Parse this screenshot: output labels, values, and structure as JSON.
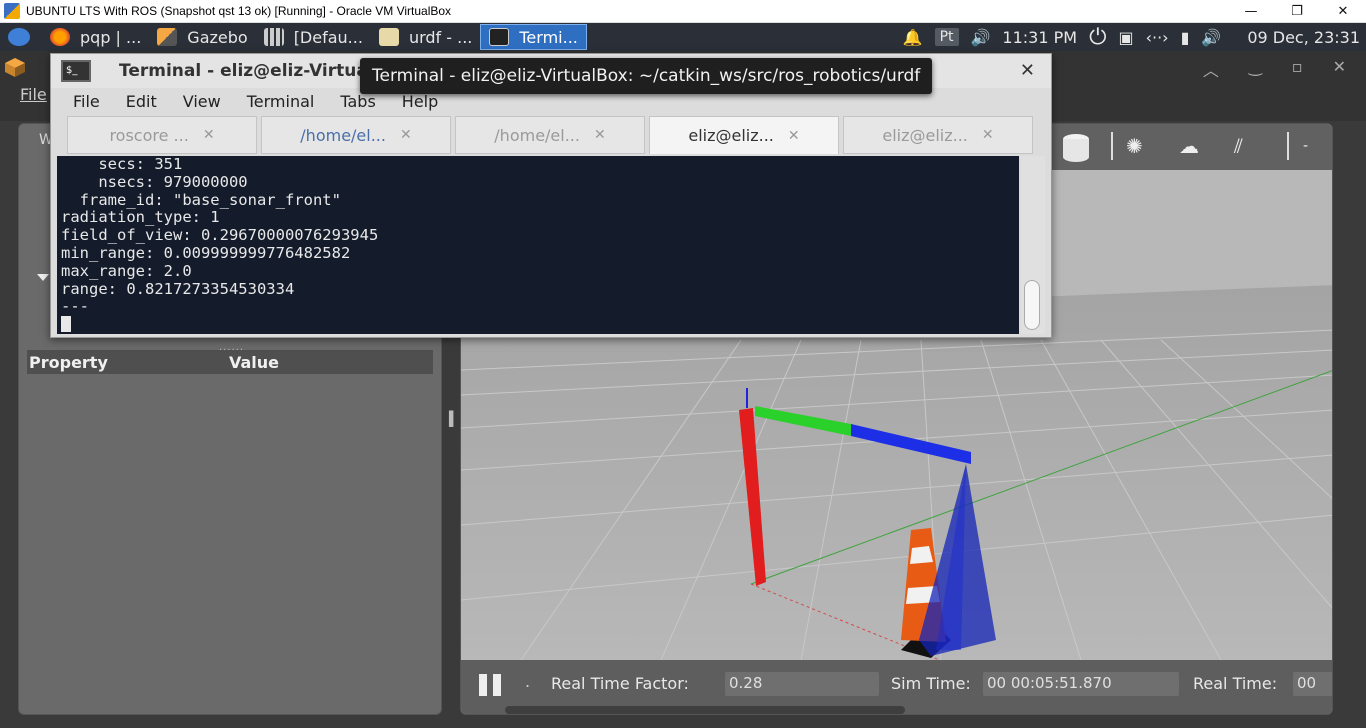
{
  "vbox": {
    "title": "UBUNTU LTS With ROS (Snapshot qst 13 ok) [Running] - Oracle VM VirtualBox",
    "minimize": "—",
    "restore": "❐",
    "close": "✕"
  },
  "panel": {
    "items": [
      {
        "label": "pqp | ..."
      },
      {
        "label": "Gazebo"
      },
      {
        "label": "[Defau..."
      },
      {
        "label": "urdf - ..."
      },
      {
        "label": "Termi..."
      }
    ],
    "lang": "Pt",
    "clock": "11:31 PM",
    "date": "09 Dec, 23:31"
  },
  "gazebo": {
    "file_menu": "File",
    "left_tab": "W",
    "property_header": "Property",
    "value_header": "Value",
    "real_time_factor_label": "Real Time Factor:",
    "real_time_factor": "0.28",
    "sim_time_label": "Sim Time:",
    "sim_time": "00 00:05:51.870",
    "real_time_label": "Real Time:",
    "real_time": "00"
  },
  "terminal": {
    "title": "Terminal - eliz@eliz-VirtualBox: ~/catkin_ws/src/ros_robotics/urdf",
    "menu": [
      "File",
      "Edit",
      "View",
      "Terminal",
      "Tabs",
      "Help"
    ],
    "tabs": [
      {
        "label": "roscore ..."
      },
      {
        "label": "/home/el..."
      },
      {
        "label": "/home/el..."
      },
      {
        "label": "eliz@eliz..."
      },
      {
        "label": "eliz@eliz..."
      }
    ],
    "lines": [
      "    secs: 351",
      "    nsecs: 979000000",
      "  frame_id: \"base_sonar_front\"",
      "radiation_type: 1",
      "field_of_view: 0.29670000076293945",
      "min_range: 0.009999999776482582",
      "max_range: 2.0",
      "range: 0.8217273354530334",
      "---"
    ]
  },
  "tooltip": "Terminal - eliz@eliz-VirtualBox: ~/catkin_ws/src/ros_robotics/urdf"
}
